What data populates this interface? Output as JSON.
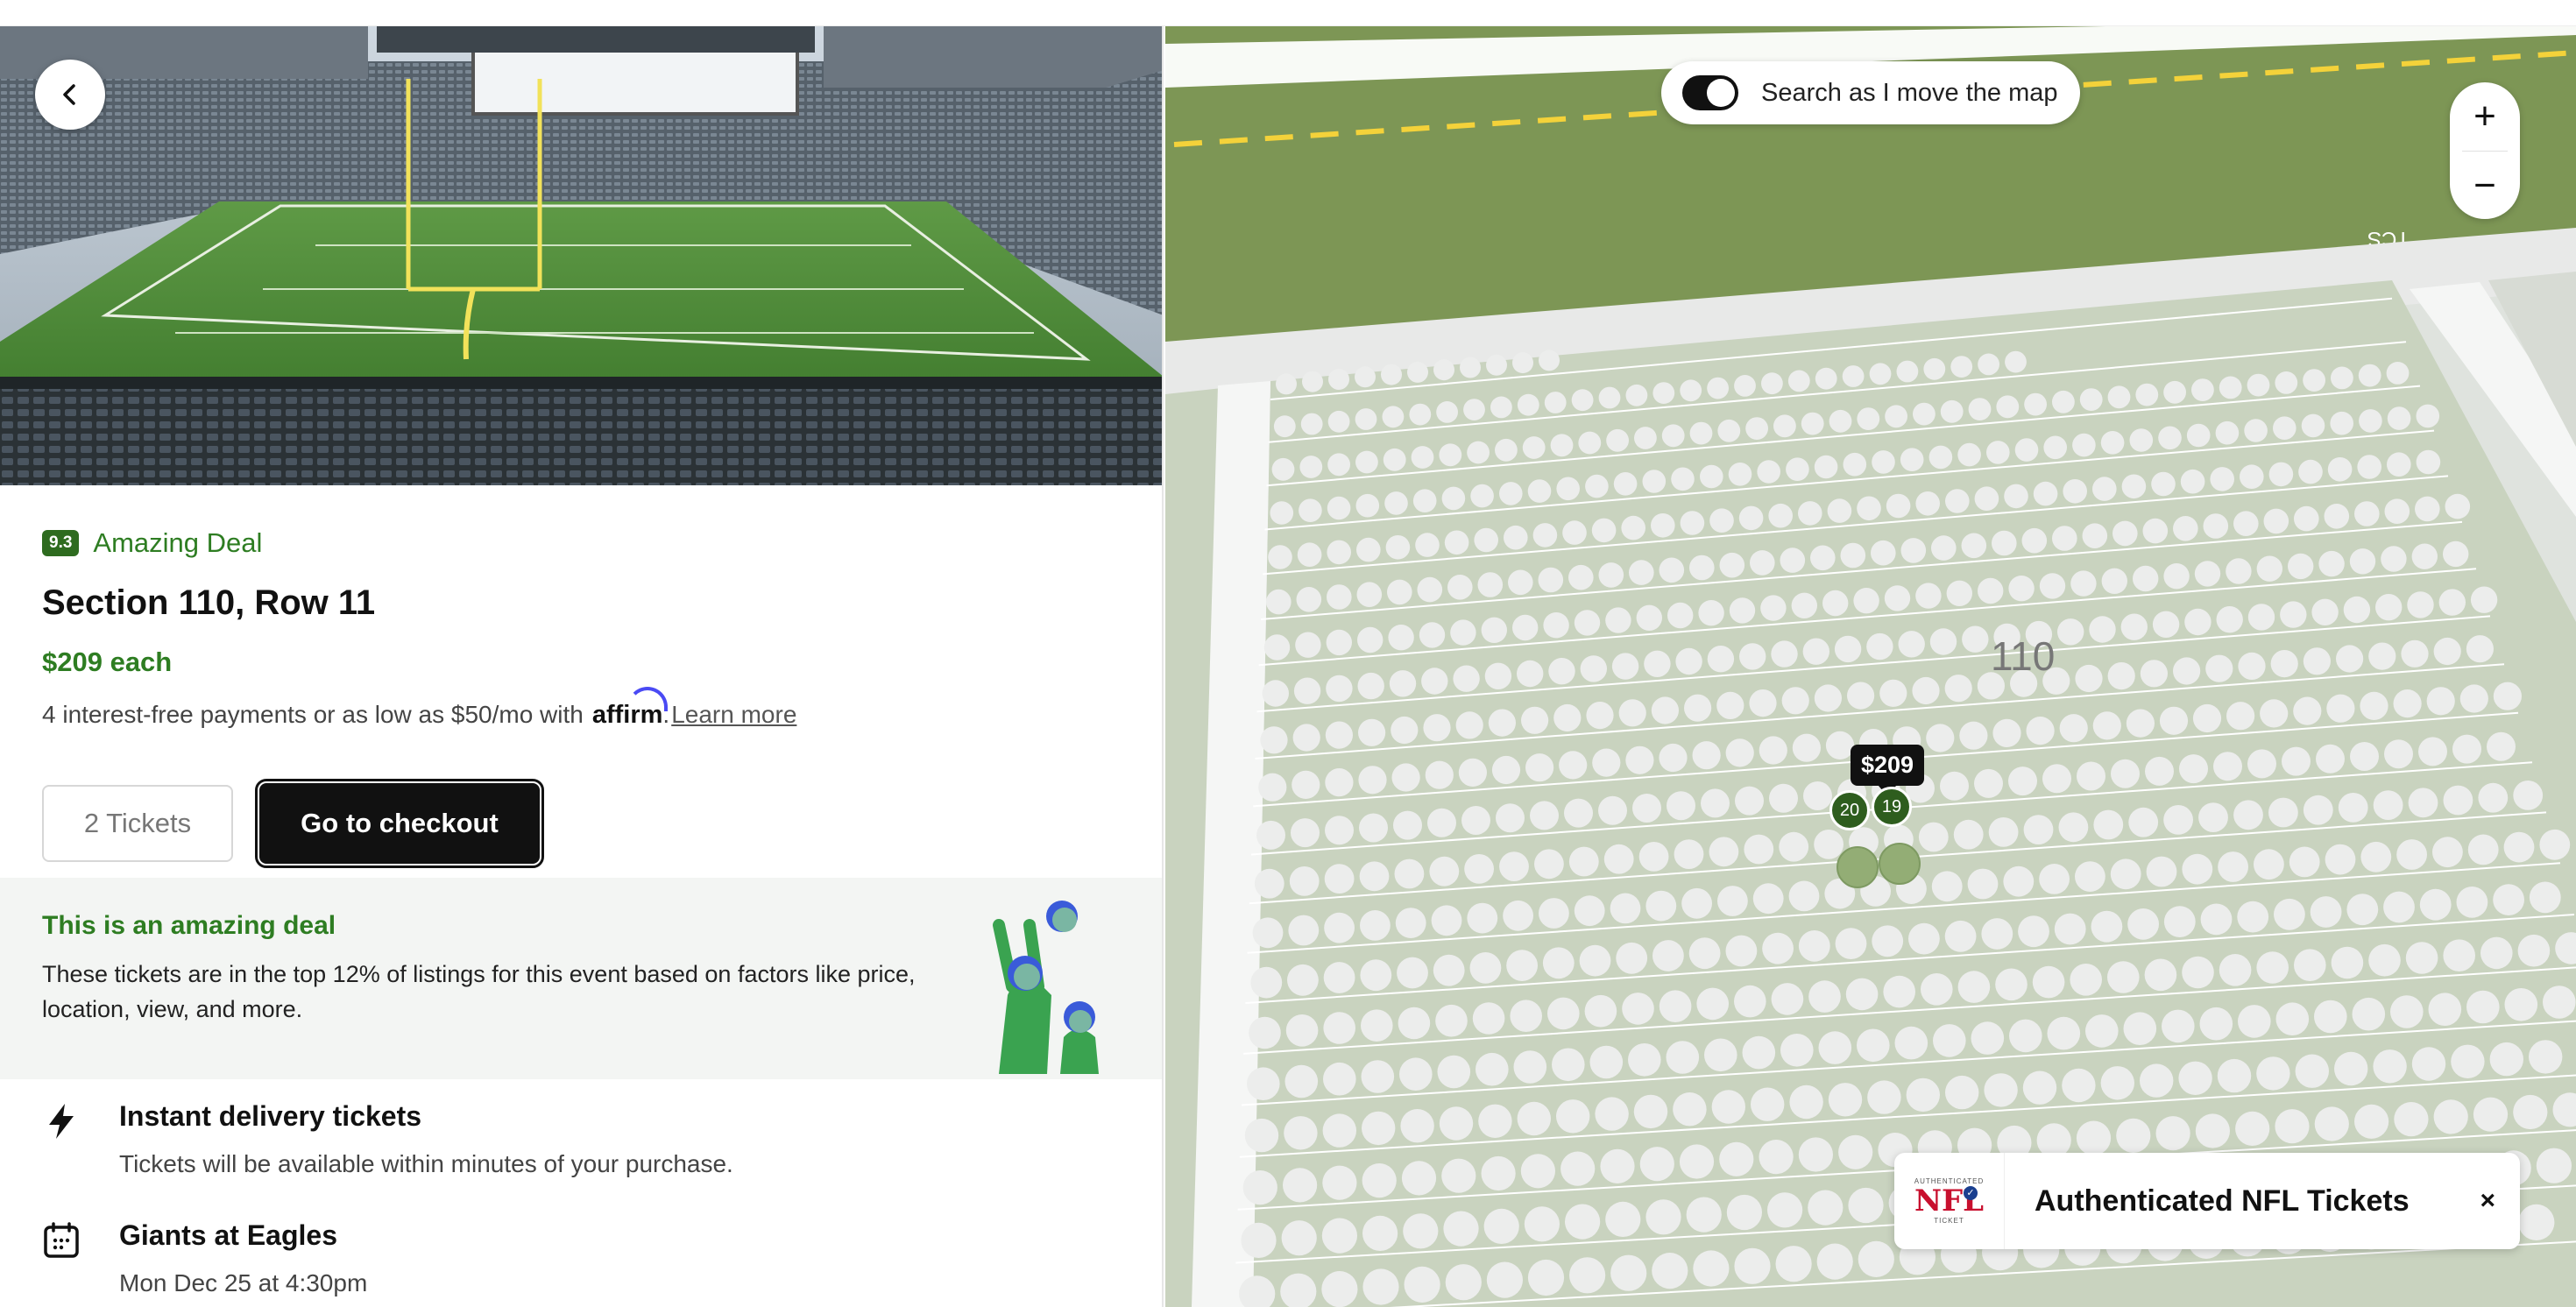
{
  "listing": {
    "score": "9.3",
    "deal_label": "Amazing Deal",
    "title": "Section 110, Row 11",
    "price": "$209 each",
    "affirm_text": "4 interest-free payments or as low as $50/mo with",
    "affirm_brand": "affirm",
    "affirm_period": ".",
    "learn_more": "Learn more",
    "quantity_label": "2 Tickets",
    "checkout_label": "Go to checkout"
  },
  "deal_box": {
    "title": "This is an amazing deal",
    "text": "These tickets are in the top 12% of listings for this event based on factors like price, location, view, and more."
  },
  "features": [
    {
      "icon": "lightning-icon",
      "title": "Instant delivery tickets",
      "subtitle": "Tickets will be available within minutes of your purchase."
    },
    {
      "icon": "calendar-icon",
      "title": "Giants at Eagles",
      "subtitle": "Mon Dec 25 at 4:30pm"
    }
  ],
  "map": {
    "search_toggle_label": "Search as I move the map",
    "search_toggle_on": true,
    "zoom_in": "+",
    "zoom_out": "−",
    "section_label": "110",
    "price_tag": "$209",
    "seat_a": "20",
    "seat_b": "19",
    "field_text": "TCS",
    "field_color": "#7d9655",
    "seat_color": "#ecedec",
    "section_color": "#c9d3bf",
    "selected_color": "#2e5d1e"
  },
  "auth_banner": {
    "logo_small_top": "AUTHENTICATED",
    "logo_main": "NFL",
    "logo_small_bottom": "TICKET",
    "text": "Authenticated NFL Tickets",
    "close": "×"
  },
  "colors": {
    "accent_green": "#2e7d22",
    "badge_green": "#2e6b1f",
    "button_black": "#111111"
  }
}
